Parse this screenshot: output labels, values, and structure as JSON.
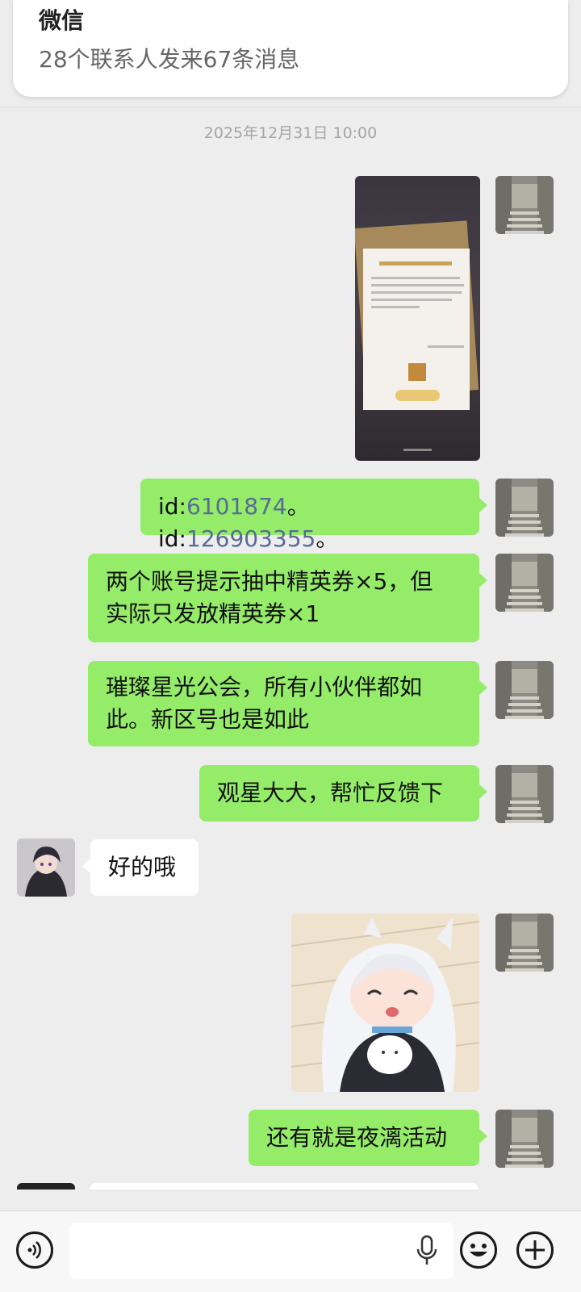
{
  "notification": {
    "app_name": "微信",
    "summary": "28个联系人发来67条消息"
  },
  "chat": {
    "timestamp": "2025年12月31日 10:00",
    "messages": [
      {
        "sender": "me",
        "type": "image",
        "image_text": "“领取奖励”活动"
      },
      {
        "sender": "me",
        "type": "text",
        "parts": [
          "id:",
          "6101874",
          "。id:",
          "126903355",
          "。"
        ]
      },
      {
        "sender": "me",
        "type": "text",
        "lines": [
          "两个账号提示抽中精英券×5，但",
          "实际只发放精英券×1"
        ]
      },
      {
        "sender": "me",
        "type": "text",
        "lines": [
          "璀璨星光公会，所有小伙伴都如",
          "此。新区号也是如此"
        ]
      },
      {
        "sender": "me",
        "type": "text",
        "text": "观星大大，帮忙反馈下"
      },
      {
        "sender": "other",
        "type": "text",
        "text": "好的哦"
      },
      {
        "sender": "me",
        "type": "sticker",
        "description": "anime-girl-hugging-cat"
      },
      {
        "sender": "me",
        "type": "text",
        "text": "还有就是夜漓活动"
      }
    ]
  },
  "input_bar": {
    "voice_icon": "voice-icon",
    "mic_icon": "microphone-icon",
    "emoji_icon": "emoji-icon",
    "plus_icon": "plus-icon",
    "input_value": ""
  },
  "colors": {
    "my_bubble": "#95ec69",
    "their_bubble": "#ffffff",
    "background": "#ededed",
    "link": "#576b95"
  }
}
